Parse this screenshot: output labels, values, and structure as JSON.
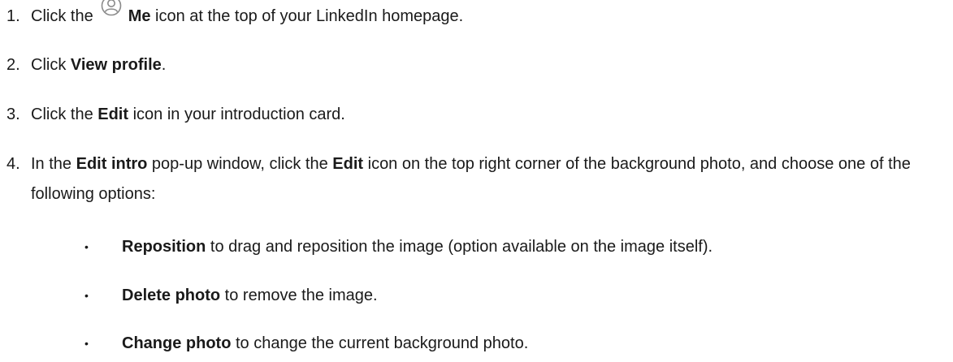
{
  "steps": [
    {
      "number": "1.",
      "before": "Click the",
      "icon": "me-profile-icon",
      "bold": "Me",
      "after": " icon at the top of your LinkedIn homepage."
    },
    {
      "number": "2.",
      "before": "Click ",
      "bold": "View profile",
      "after": "."
    },
    {
      "number": "3.",
      "before": "Click the ",
      "bold": "Edit",
      "after": " icon in your introduction card."
    },
    {
      "number": "4.",
      "before": "In the ",
      "bold": "Edit intro",
      "middle": " pop-up window, click the ",
      "bold2": "Edit",
      "after": " icon on the top right corner of the background photo, and choose one of the following options:"
    }
  ],
  "options": [
    {
      "bullet": "•",
      "bold": "Reposition",
      "text": " to drag and reposition the image (option available on the image itself)."
    },
    {
      "bullet": "•",
      "bold": "Delete photo",
      "text": " to remove the image."
    },
    {
      "bullet": "•",
      "bold": "Change photo",
      "text": " to change the current background photo."
    }
  ],
  "colors": {
    "text": "#1a1a1a",
    "icon": "#8a8a8a"
  }
}
